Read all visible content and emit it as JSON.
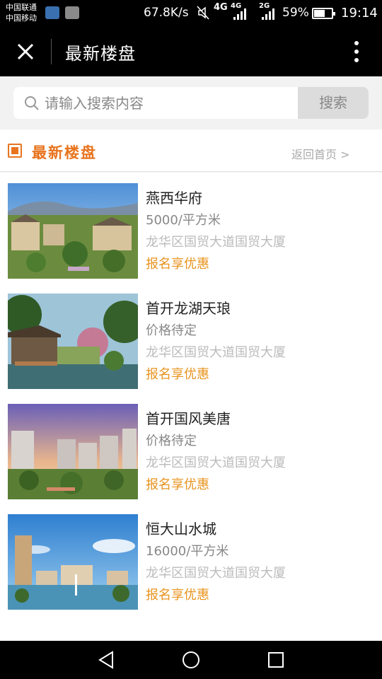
{
  "status_bar": {
    "carrier1": "中国联通",
    "carrier2": "中国移动",
    "speed": "67.8K/s",
    "network1": "4G",
    "network2": "4G",
    "network3": "2G",
    "battery_pct": "59%",
    "battery_level": 0.59,
    "time": "19:14",
    "icons": [
      "wechat-app-icon",
      "gallery-app-icon",
      "mute-icon",
      "signal-icon",
      "battery-icon"
    ]
  },
  "header": {
    "title": "最新楼盘",
    "icons": [
      "close-icon",
      "more-vertical-icon"
    ]
  },
  "search": {
    "placeholder": "请输入搜索内容",
    "button_label": "搜索",
    "icon": "search-icon"
  },
  "section": {
    "title": "最新楼盘",
    "back_link": "返回首页 >",
    "icon": "building-icon",
    "accent_color": "#e8741e"
  },
  "listings": [
    {
      "name": "燕西华府",
      "price": "5000/平方米",
      "address": "龙华区国贸大道国贸大厦",
      "promo": "报名享优惠"
    },
    {
      "name": "首开龙湖天琅",
      "price": "价格待定",
      "address": "龙华区国贸大道国贸大厦",
      "promo": "报名享优惠"
    },
    {
      "name": "首开国风美唐",
      "price": "价格待定",
      "address": "龙华区国贸大道国贸大厦",
      "promo": "报名享优惠"
    },
    {
      "name": "恒大山水城",
      "price": "16000/平方米",
      "address": "龙华区国贸大道国贸大厦",
      "promo": "报名享优惠"
    }
  ],
  "colors": {
    "promo": "#e8931e",
    "bar_background": "#000000"
  },
  "nav": {
    "icons": [
      "back-triangle-icon",
      "home-circle-icon",
      "recent-square-icon"
    ]
  }
}
